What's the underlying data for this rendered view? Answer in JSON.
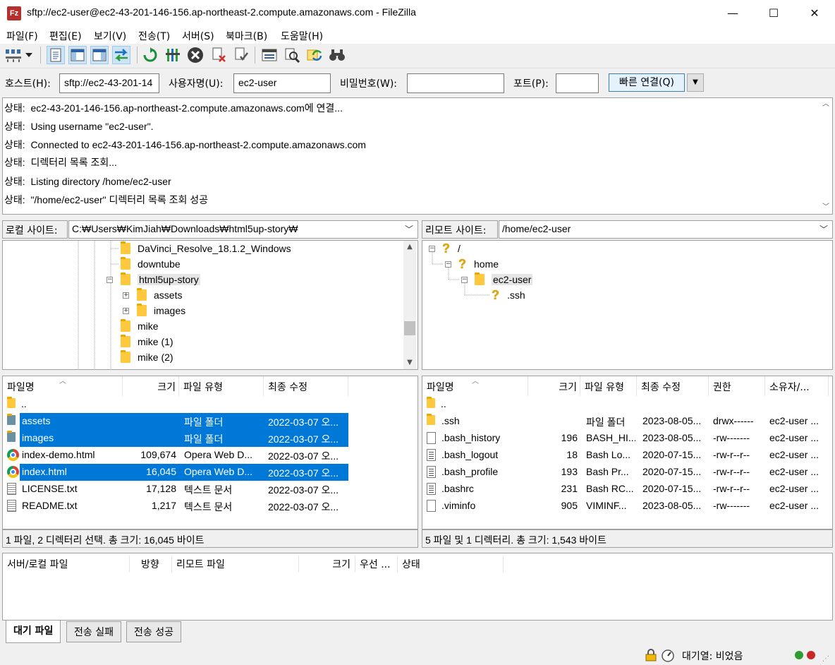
{
  "window": {
    "title": "sftp://ec2-user@ec2-43-201-146-156.ap-northeast-2.compute.amazonaws.com - FileZilla",
    "app_icon_text": "Fz",
    "minimize": "—",
    "maximize": "☐",
    "close": "✕"
  },
  "menu": [
    {
      "label": "파일(F)"
    },
    {
      "label": "편집(E)"
    },
    {
      "label": "보기(V)"
    },
    {
      "label": "전송(T)"
    },
    {
      "label": "서버(S)"
    },
    {
      "label": "북마크(B)"
    },
    {
      "label": "도움말(H)"
    }
  ],
  "toolbar": {
    "icons": [
      "site-manager-icon",
      "dropdown-arrow-icon",
      "toggle-log-icon",
      "toggle-local-tree-icon",
      "toggle-remote-tree-icon",
      "toggle-queue-icon",
      "refresh-icon",
      "process-queue-icon",
      "cancel-icon",
      "disconnect-icon",
      "reconnect-icon",
      "directory-compare-icon",
      "filter-icon",
      "sync-browse-icon",
      "search-icon"
    ]
  },
  "quickconnect": {
    "host_label": "호스트(H):",
    "host_value": "sftp://ec2-43-201-14",
    "user_label": "사용자명(U):",
    "user_value": "ec2-user",
    "pass_label": "비밀번호(W):",
    "pass_value": "",
    "port_label": "포트(P):",
    "port_value": "",
    "connect_label": "빠른 연결(Q)",
    "dropdown": "▼"
  },
  "log": [
    {
      "prefix": "상태:",
      "text": "ec2-43-201-146-156.ap-northeast-2.compute.amazonaws.com에 연결..."
    },
    {
      "prefix": "상태:",
      "text": "Using username \"ec2-user\"."
    },
    {
      "prefix": "상태:",
      "text": "Connected to ec2-43-201-146-156.ap-northeast-2.compute.amazonaws.com"
    },
    {
      "prefix": "상태:",
      "text": "디렉터리 목록 조회..."
    },
    {
      "prefix": "상태:",
      "text": "Listing directory /home/ec2-user"
    },
    {
      "prefix": "상태:",
      "text": "\"/home/ec2-user\" 디렉터리 목록 조회 성공"
    }
  ],
  "local": {
    "site_label": "로컬 사이트:",
    "path": "C:₩Users₩KimJiah₩Downloads₩html5up-story₩",
    "tree": [
      {
        "label": "DaVinci_Resolve_18.1.2_Windows",
        "indent": 0,
        "expander": ""
      },
      {
        "label": "downtube",
        "indent": 0,
        "expander": ""
      },
      {
        "label": "html5up-story",
        "indent": 0,
        "expander": "−"
      },
      {
        "label": "assets",
        "indent": 1,
        "expander": "+"
      },
      {
        "label": "images",
        "indent": 1,
        "expander": "+"
      },
      {
        "label": "mike",
        "indent": 0,
        "expander": ""
      },
      {
        "label": "mike (1)",
        "indent": 0,
        "expander": ""
      },
      {
        "label": "mike (2)",
        "indent": 0,
        "expander": ""
      }
    ],
    "columns": [
      "파일명",
      "크기",
      "파일 유형",
      "최종 수정"
    ],
    "files": [
      {
        "name": "..",
        "size": "",
        "type": "",
        "modified": "",
        "icon": "folder",
        "selected": false
      },
      {
        "name": "assets",
        "size": "",
        "type": "파일 폴더",
        "modified": "2022-03-07 오...",
        "icon": "folder-dark",
        "selected": true
      },
      {
        "name": "images",
        "size": "",
        "type": "파일 폴더",
        "modified": "2022-03-07 오...",
        "icon": "folder-dark",
        "selected": true
      },
      {
        "name": "index-demo.html",
        "size": "109,674",
        "type": "Opera Web D...",
        "modified": "2022-03-07 오...",
        "icon": "chrome",
        "selected": false
      },
      {
        "name": "index.html",
        "size": "16,045",
        "type": "Opera Web D...",
        "modified": "2022-03-07 오...",
        "icon": "chrome",
        "selected": true
      },
      {
        "name": "LICENSE.txt",
        "size": "17,128",
        "type": "텍스트 문서",
        "modified": "2022-03-07 오...",
        "icon": "txt",
        "selected": false
      },
      {
        "name": "README.txt",
        "size": "1,217",
        "type": "텍스트 문서",
        "modified": "2022-03-07 오...",
        "icon": "txt",
        "selected": false
      }
    ],
    "status": "1 파일, 2 디렉터리 선택. 총 크기: 16,045 바이트"
  },
  "remote": {
    "site_label": "리모트 사이트:",
    "path": "/home/ec2-user",
    "tree": [
      {
        "label": "/",
        "icon": "question",
        "indent": 0,
        "expander": "−"
      },
      {
        "label": "home",
        "icon": "question",
        "indent": 1,
        "expander": "−"
      },
      {
        "label": "ec2-user",
        "icon": "folder",
        "indent": 2,
        "expander": "−"
      },
      {
        "label": ".ssh",
        "icon": "question",
        "indent": 3,
        "expander": ""
      }
    ],
    "columns": [
      "파일명",
      "크기",
      "파일 유형",
      "최종 수정",
      "권한",
      "소유자/..."
    ],
    "files": [
      {
        "name": "..",
        "size": "",
        "type": "",
        "modified": "",
        "perm": "",
        "owner": "",
        "icon": "folder"
      },
      {
        "name": ".ssh",
        "size": "",
        "type": "파일 폴더",
        "modified": "2023-08-05...",
        "perm": "drwx------",
        "owner": "ec2-user ...",
        "icon": "folder"
      },
      {
        "name": ".bash_history",
        "size": "196",
        "type": "BASH_HI...",
        "modified": "2023-08-05...",
        "perm": "-rw-------",
        "owner": "ec2-user ...",
        "icon": "doc"
      },
      {
        "name": ".bash_logout",
        "size": "18",
        "type": "Bash Lo...",
        "modified": "2020-07-15...",
        "perm": "-rw-r--r--",
        "owner": "ec2-user ...",
        "icon": "doc-dark"
      },
      {
        "name": ".bash_profile",
        "size": "193",
        "type": "Bash Pr...",
        "modified": "2020-07-15...",
        "perm": "-rw-r--r--",
        "owner": "ec2-user ...",
        "icon": "doc-dark"
      },
      {
        "name": ".bashrc",
        "size": "231",
        "type": "Bash RC...",
        "modified": "2020-07-15...",
        "perm": "-rw-r--r--",
        "owner": "ec2-user ...",
        "icon": "doc-dark"
      },
      {
        "name": ".viminfo",
        "size": "905",
        "type": "VIMINF...",
        "modified": "2023-08-05...",
        "perm": "-rw-------",
        "owner": "ec2-user ...",
        "icon": "doc"
      }
    ],
    "status": "5 파일 및 1 디렉터리. 총 크기: 1,543 바이트"
  },
  "queue": {
    "columns": [
      "서버/로컬 파일",
      "방향",
      "리모트 파일",
      "크기",
      "우선 ...",
      "상태"
    ],
    "tabs": [
      {
        "label": "대기 파일",
        "active": true
      },
      {
        "label": "전송 실패",
        "active": false
      },
      {
        "label": "전송 성공",
        "active": false
      }
    ]
  },
  "statusbar": {
    "queue_text": "대기열: 비었음"
  },
  "colors": {
    "selection": "#0078d7",
    "folder": "#ffc83d",
    "led_green": "#2e9c2e",
    "led_red": "#c62828"
  }
}
